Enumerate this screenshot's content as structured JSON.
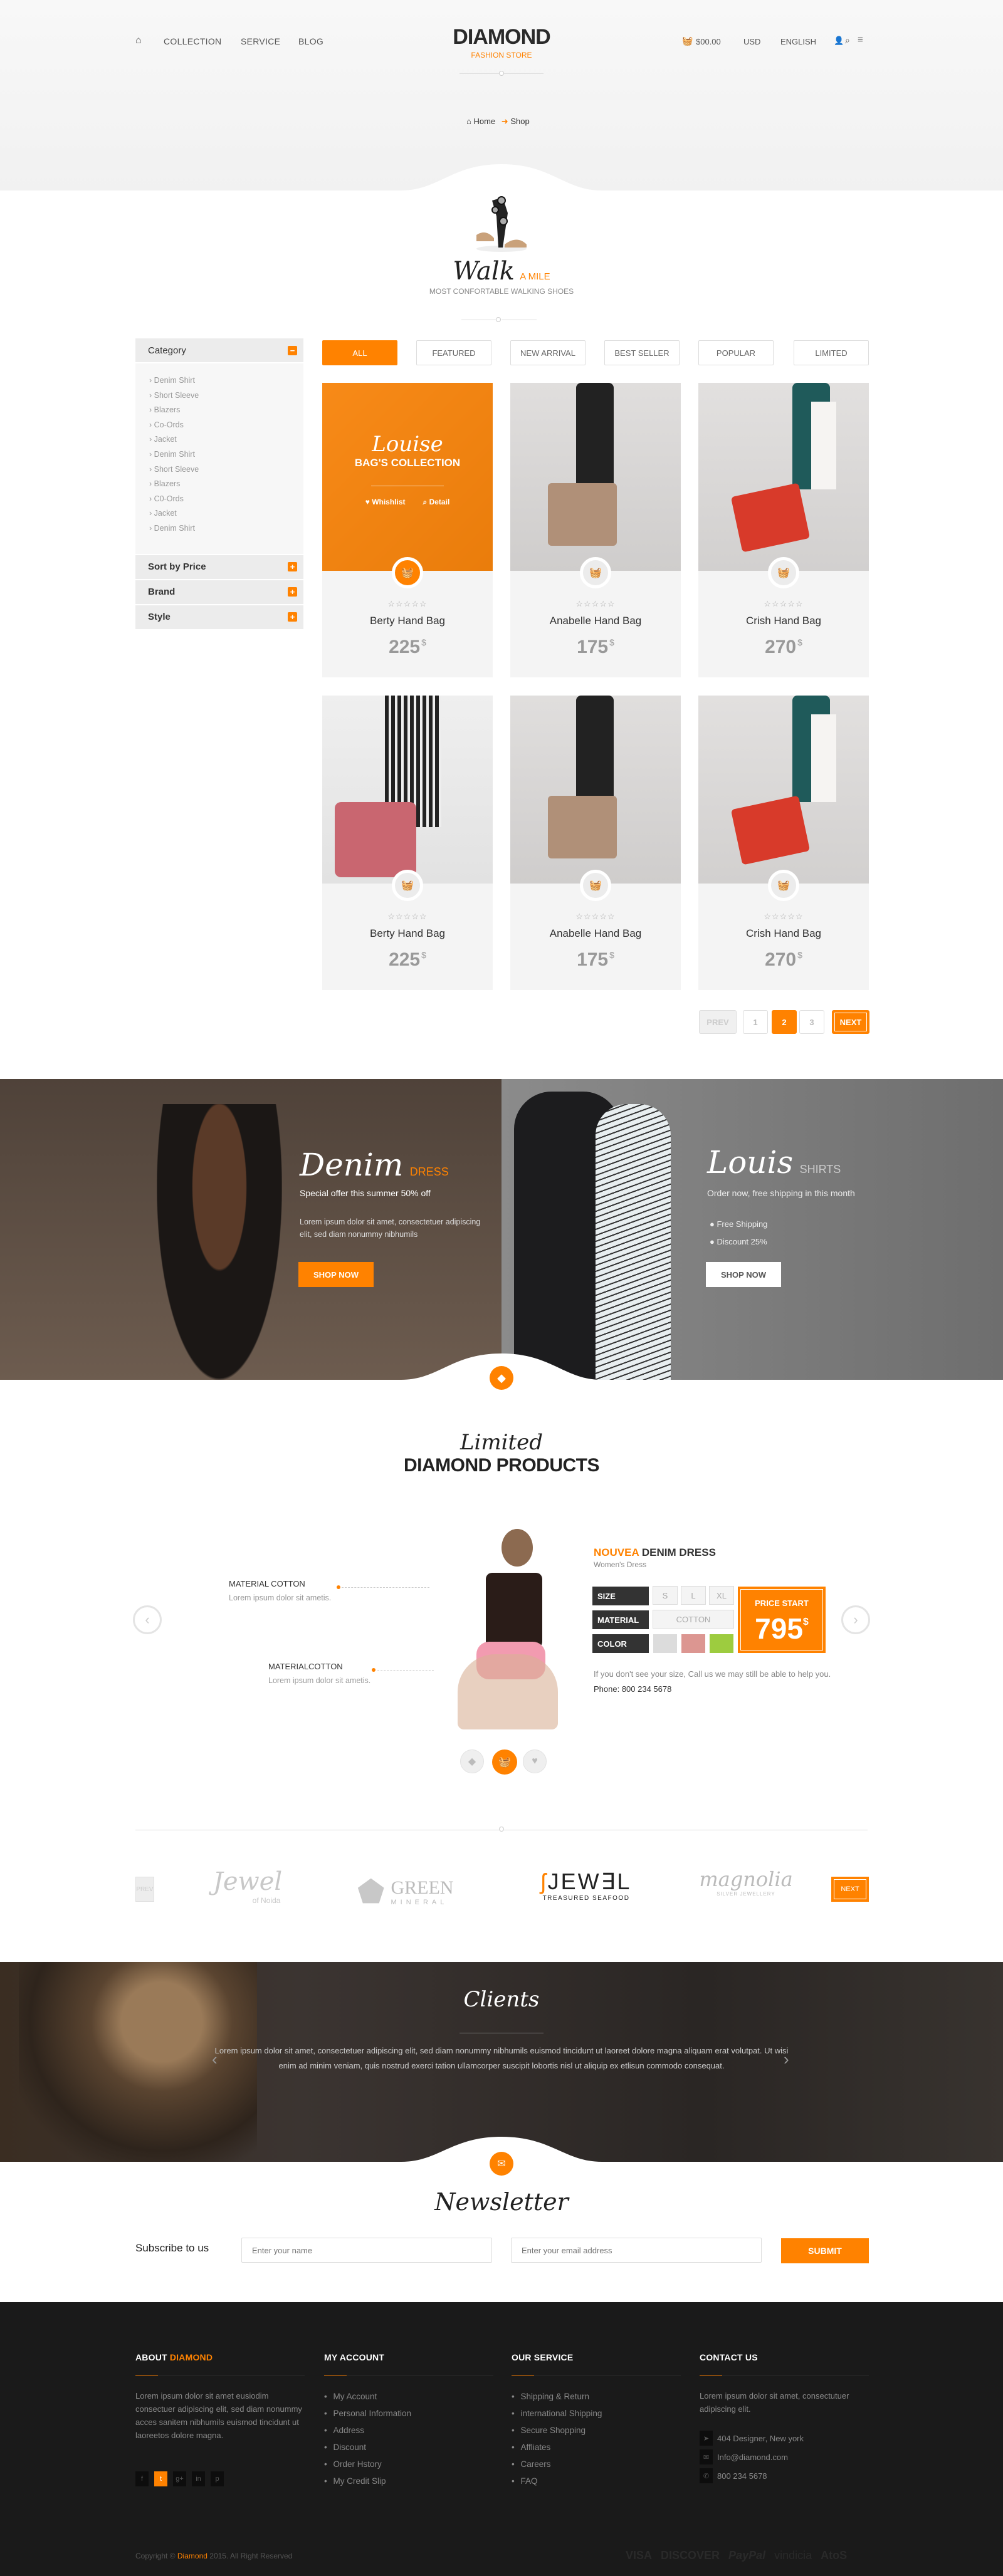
{
  "header": {
    "nav": [
      "COLLECTION",
      "SERVICE",
      "BLOG"
    ],
    "logo": "DIAMOND",
    "logo_sub": "FASHION STORE",
    "cart": "$00.00",
    "currency": "USD",
    "language": "ENGLISH",
    "breadcrumb": {
      "home": "Home",
      "current": "Shop"
    }
  },
  "hero": {
    "script": "Walk",
    "accent": "A MILE",
    "subtitle": "MOST CONFORTABLE WALKING SHOES"
  },
  "sidebar": {
    "category_title": "Category",
    "category_items": [
      "Denim Shirt",
      "Short Sleeve",
      "Blazers",
      "Co-Ords",
      "Jacket",
      "Denim Shirt",
      "Short Sleeve",
      "Blazers",
      "C0-Ords",
      "Jacket",
      "Denim Shirt"
    ],
    "sections": [
      "Sort by Price",
      "Brand",
      "Style"
    ]
  },
  "filters": [
    "ALL",
    "FEATURED",
    "NEW ARRIVAL",
    "BEST SELLER",
    "POPULAR",
    "LIMITED"
  ],
  "products": [
    {
      "name": "Berty Hand Bag",
      "price": "225",
      "currency": "$",
      "rating": 0,
      "overlay": {
        "script": "Louise",
        "title": "BAG'S COLLECTION",
        "wishlist": "Whishlist",
        "detail": "Detail"
      }
    },
    {
      "name": "Anabelle Hand Bag",
      "price": "175",
      "currency": "$",
      "rating": 0
    },
    {
      "name": "Crish Hand Bag",
      "price": "270",
      "currency": "$",
      "rating": 0
    },
    {
      "name": "Berty Hand Bag",
      "price": "225",
      "currency": "$",
      "rating": 0
    },
    {
      "name": "Anabelle Hand Bag",
      "price": "175",
      "currency": "$",
      "rating": 0
    },
    {
      "name": "Crish Hand Bag",
      "price": "270",
      "currency": "$",
      "rating": 0
    }
  ],
  "pagination": {
    "prev": "PREV",
    "pages": [
      "1",
      "2",
      "3"
    ],
    "current": "2",
    "next": "NEXT"
  },
  "banners": {
    "left": {
      "script": "Denim",
      "accent": "DRESS",
      "tagline": "Special offer this summer 50% off",
      "text": "Lorem ipsum dolor sit amet, consectetuer adipiscing elit, sed diam nonummy nibhumils",
      "button": "SHOP NOW"
    },
    "right": {
      "script": "Louis",
      "accent": "SHIRTS",
      "tagline": "Order now, free shipping in this month",
      "bullets": [
        "Free Shipping",
        "Discount 25%"
      ],
      "button": "SHOP NOW"
    }
  },
  "limited": {
    "script": "Limited",
    "title": "DIAMOND PRODUCTS",
    "callouts": [
      {
        "title": "MATERIAL COTTON",
        "text": "Lorem ipsum dolor sit ametis."
      },
      {
        "title": "MATERIALCOTTON",
        "text": "Lorem ipsum dolor sit ametis."
      }
    ],
    "product": {
      "name_accent": "NOUVEA",
      "name": "DENIM DRESS",
      "category": "Women's Dress",
      "size_label": "SIZE",
      "sizes": [
        "S",
        "L",
        "XL"
      ],
      "material_label": "MATERIAL",
      "material": "COTTON",
      "color_label": "COLOR",
      "colors": [
        "#dcdcdc",
        "#dc9691",
        "#9dcc3f"
      ],
      "price_label": "PRICE START",
      "price": "795",
      "currency": "$",
      "note": "If you don't see your size, Call us we may still be able to help you.",
      "phone": "Phone: 800 234 5678"
    }
  },
  "brands": {
    "prev": "PREV",
    "next": "NEXT",
    "logos": [
      {
        "name": "Jewel",
        "sub": "of Noida"
      },
      {
        "name": "GREEN",
        "sub": "MINERAL"
      },
      {
        "name": "JEW∃L",
        "sub": "TREASURED SEAFOOD"
      },
      {
        "name": "magnolia",
        "sub": "SILVER JEWELLERY"
      }
    ]
  },
  "clients": {
    "script": "Clients",
    "text": "Lorem ipsum dolor sit amet, consectetuer adipiscing elit, sed diam nonummy nibhumils euismod tincidunt ut laoreet dolore magna aliquam erat volutpat. Ut wisi enim ad minim veniam, quis nostrud exerci tation ullamcorper suscipit lobortis nisl ut aliquip ex etlisun commodo consequat."
  },
  "newsletter": {
    "script": "Newsletter",
    "label": "Subscribe to us",
    "name_placeholder": "Enter your name",
    "email_placeholder": "Enter your email address",
    "submit": "SUBMIT"
  },
  "footer": {
    "about": {
      "title": "ABOUT",
      "title_accent": "DIAMOND",
      "text": "Lorem ipsum dolor sit amet eusiodim consectuer adipiscing elit, sed diam nonummy acces sanitem nibhumils euismod tincidunt ut laoreetos dolore magna.",
      "social": [
        "f",
        "t",
        "g+",
        "in",
        "p"
      ]
    },
    "account": {
      "title": "MY ACCOUNT",
      "items": [
        "My Account",
        "Personal Information",
        "Address",
        "Discount",
        "Order Hstory",
        "My Credit Slip"
      ]
    },
    "service": {
      "title": "OUR SERVICE",
      "items": [
        "Shipping & Return",
        "international Shipping",
        "Secure Shopping",
        "Affliates",
        "Careers",
        "FAQ"
      ]
    },
    "contact": {
      "title": "CONTACT US",
      "text": "Lorem ipsum dolor sit amet, consectutuer adipiscing elit.",
      "address": "404 Designer, New york",
      "email": "Info@diamond.com",
      "phone": "800 234 5678"
    },
    "copyright_pre": "Copyright ©",
    "copyright_brand": "Diamond",
    "copyright_post": "2015.  All Right Reserved",
    "payments": [
      "VISA",
      "DISCOVER",
      "PayPal",
      "vindicia",
      "AtoS"
    ]
  },
  "colors": {
    "accent": "#ff8200",
    "dark": "#1a1a1a"
  }
}
